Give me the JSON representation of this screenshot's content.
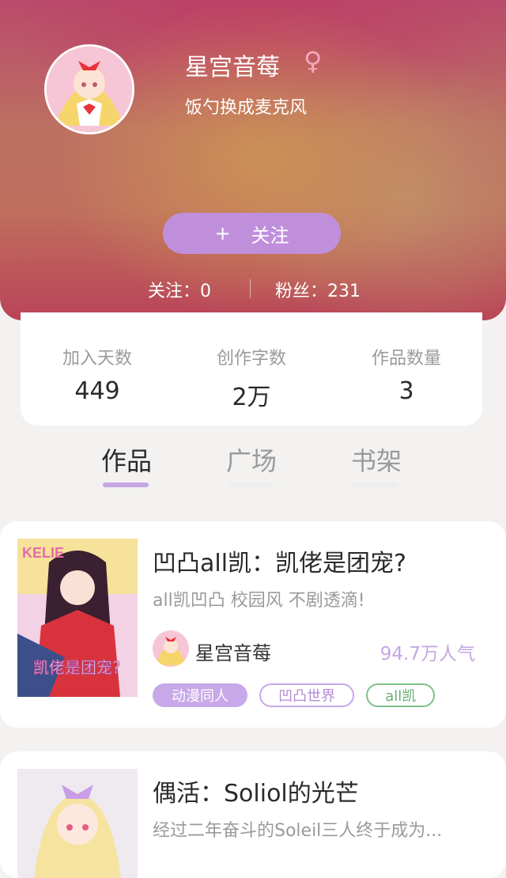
{
  "profile": {
    "name": "星宫音莓",
    "gender_symbol": "♀",
    "signature": "饭勺换成麦克风",
    "follow_button": {
      "plus": "+",
      "label": "关注"
    },
    "follows_text": "关注：0",
    "fans_text": "粉丝：231"
  },
  "stats": [
    {
      "label": "加入天数",
      "value": "449"
    },
    {
      "label": "创作字数",
      "value": "2万"
    },
    {
      "label": "作品数量",
      "value": "3"
    }
  ],
  "tabs": [
    {
      "label": "作品",
      "active": true
    },
    {
      "label": "广场",
      "active": false
    },
    {
      "label": "书架",
      "active": false
    }
  ],
  "works": [
    {
      "title": "凹凸all凯：凯佬是团宠?",
      "description": "all凯凹凸 校园风 不剧透滴!",
      "author": "星宫音莓",
      "popularity": "94.7万人气",
      "cover_text_top": "KELIE",
      "cover_text_bottom": "凯佬是团宠?",
      "tags": [
        "动漫同人",
        "凹凸世界",
        "all凯"
      ]
    },
    {
      "title": "偶活：Soliol的光芒",
      "description": "经过二年奋斗的Soleil三人终于成为..."
    }
  ],
  "colors": {
    "accent": "#c08fdc",
    "popularity": "#c6a6e3",
    "green_tag": "#7fc28a"
  }
}
